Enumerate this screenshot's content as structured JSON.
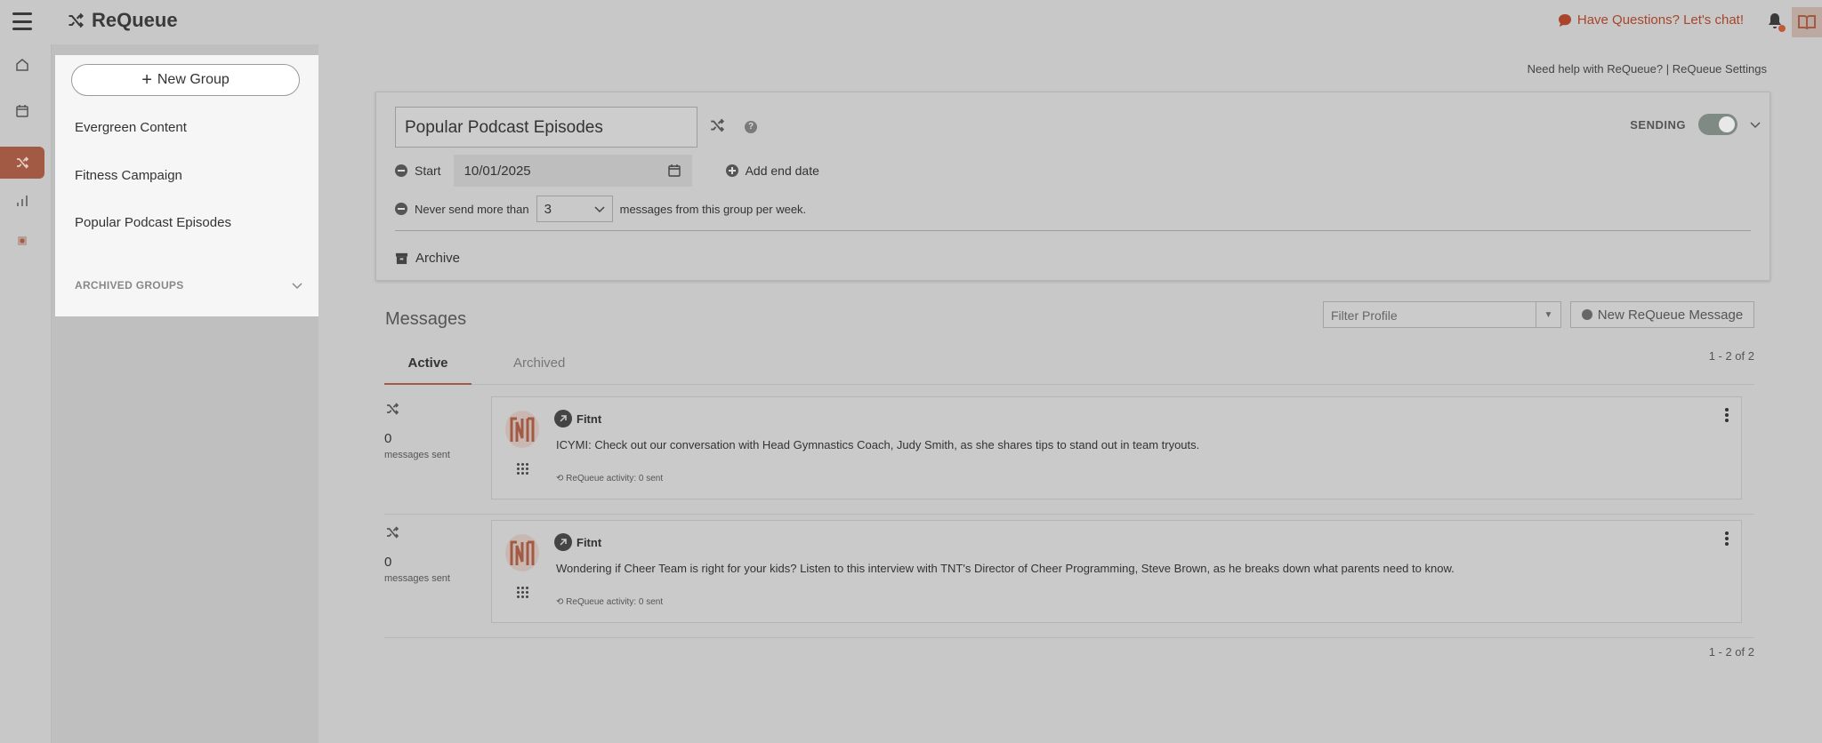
{
  "header": {
    "app_name": "ReQueue",
    "chat_link": "Have Questions? Let's chat!"
  },
  "top_links": {
    "help": "Need help with ReQueue?",
    "separator": "|",
    "settings": "ReQueue Settings"
  },
  "groups": {
    "new_group_label": "New Group",
    "items": [
      "Evergreen Content",
      "Fitness Campaign",
      "Popular Podcast Episodes"
    ],
    "archived_label": "ARCHIVED GROUPS"
  },
  "group_detail": {
    "name": "Popular Podcast Episodes",
    "help_glyph": "?",
    "sending_label": "SENDING",
    "start_label": "Start",
    "start_date": "10/01/2025",
    "add_end_label": "Add end date",
    "limit_prefix": "Never send more than",
    "limit_value": "3",
    "limit_suffix": "messages from this group per week.",
    "archive_label": "Archive"
  },
  "messages": {
    "title": "Messages",
    "filter_placeholder": "Filter Profile",
    "new_message_label": "New ReQueue Message",
    "tabs": [
      "Active",
      "Archived"
    ],
    "count_label": "1 - 2 of 2",
    "items": [
      {
        "sent_count": "0",
        "sent_label": "messages sent",
        "profile": "Fitnt",
        "text": "ICYMI: Check out our conversation with Head Gymnastics Coach, Judy Smith, as she shares tips to stand out in team tryouts.",
        "activity": "ReQueue activity: 0 sent"
      },
      {
        "sent_count": "0",
        "sent_label": "messages sent",
        "profile": "Fitnt",
        "text": "Wondering if Cheer Team is right for your kids? Listen to this interview with TNT's Director of Cheer Programming, Steve Brown, as he breaks down what parents need to know.",
        "activity": "ReQueue activity: 0 sent"
      }
    ]
  },
  "colors": {
    "accent": "#a35a44",
    "chat_link": "#a8452a",
    "overlay_bg": "#c8c8c8",
    "panel_bg": "#f6f6f6"
  }
}
